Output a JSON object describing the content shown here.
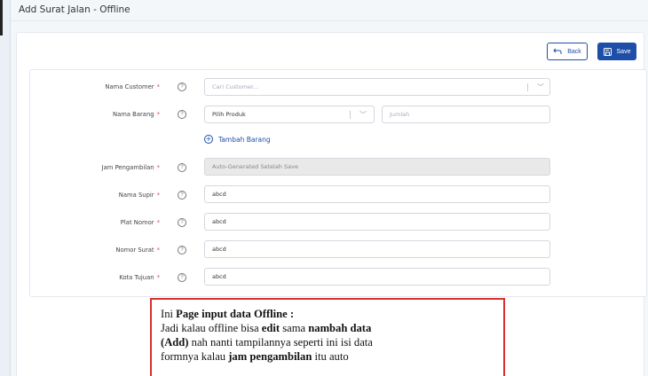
{
  "page": {
    "title": "Add Surat Jalan - Offline"
  },
  "actions": {
    "back_label": "Back",
    "save_label": "Save"
  },
  "form": {
    "customer": {
      "label": "Nama Customer",
      "placeholder": "Cari Customer..."
    },
    "barang": {
      "label": "Nama Barang",
      "select_value": "Pilih Produk",
      "qty_placeholder": "Jumlah",
      "add_label": "Tambah Barang"
    },
    "jam": {
      "label": "Jam Pengambilan",
      "value": "Auto-Generated Setelah Save"
    },
    "supir": {
      "label": "Nama Supir",
      "value": "abcd"
    },
    "plat": {
      "label": "Plat Nomor",
      "value": "abcd"
    },
    "surat": {
      "label": "Nomor Surat",
      "value": "abcd"
    },
    "kota": {
      "label": "Kota Tujuan",
      "value": "abcd"
    }
  },
  "note": {
    "line1_pre": "Ini ",
    "line1_bold": "Page input data Offline :",
    "line2_pre": "Jadi kalau offline bisa ",
    "line2_b1": "edit",
    "line2_mid": " sama ",
    "line2_b2": "nambah data",
    "line3_b": "(Add)",
    "line3_rest": " nah nanti tampilannya seperti ini isi data",
    "line4_pre": "formnya kalau ",
    "line4_b": "jam pengambilan",
    "line4_rest": " itu auto"
  },
  "icons": {
    "required_mark": "*",
    "help_glyph": "?"
  }
}
